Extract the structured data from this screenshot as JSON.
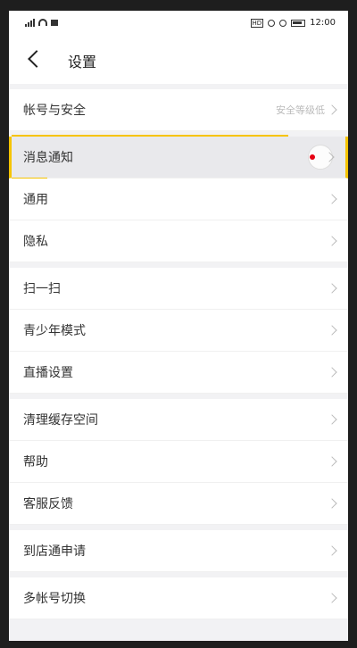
{
  "status_bar": {
    "time": "12:00",
    "hd_label": "HD"
  },
  "header": {
    "title": "设置"
  },
  "menu": [
    {
      "label": "帐号与安全",
      "hint": "安全等级低"
    },
    {
      "label": "消息通知",
      "hint": ""
    },
    {
      "label": "通用",
      "hint": ""
    },
    {
      "label": "隐私",
      "hint": ""
    },
    {
      "label": "扫一扫",
      "hint": ""
    },
    {
      "label": "青少年模式",
      "hint": ""
    },
    {
      "label": "直播设置",
      "hint": ""
    },
    {
      "label": "清理缓存空间",
      "hint": ""
    },
    {
      "label": "帮助",
      "hint": ""
    },
    {
      "label": "客服反馈",
      "hint": ""
    },
    {
      "label": "到店通申请",
      "hint": ""
    },
    {
      "label": "多帐号切换",
      "hint": ""
    }
  ],
  "colors": {
    "highlight_border": "#f6c400",
    "notification_dot": "#e60012",
    "page_bg": "#f2f2f4"
  }
}
